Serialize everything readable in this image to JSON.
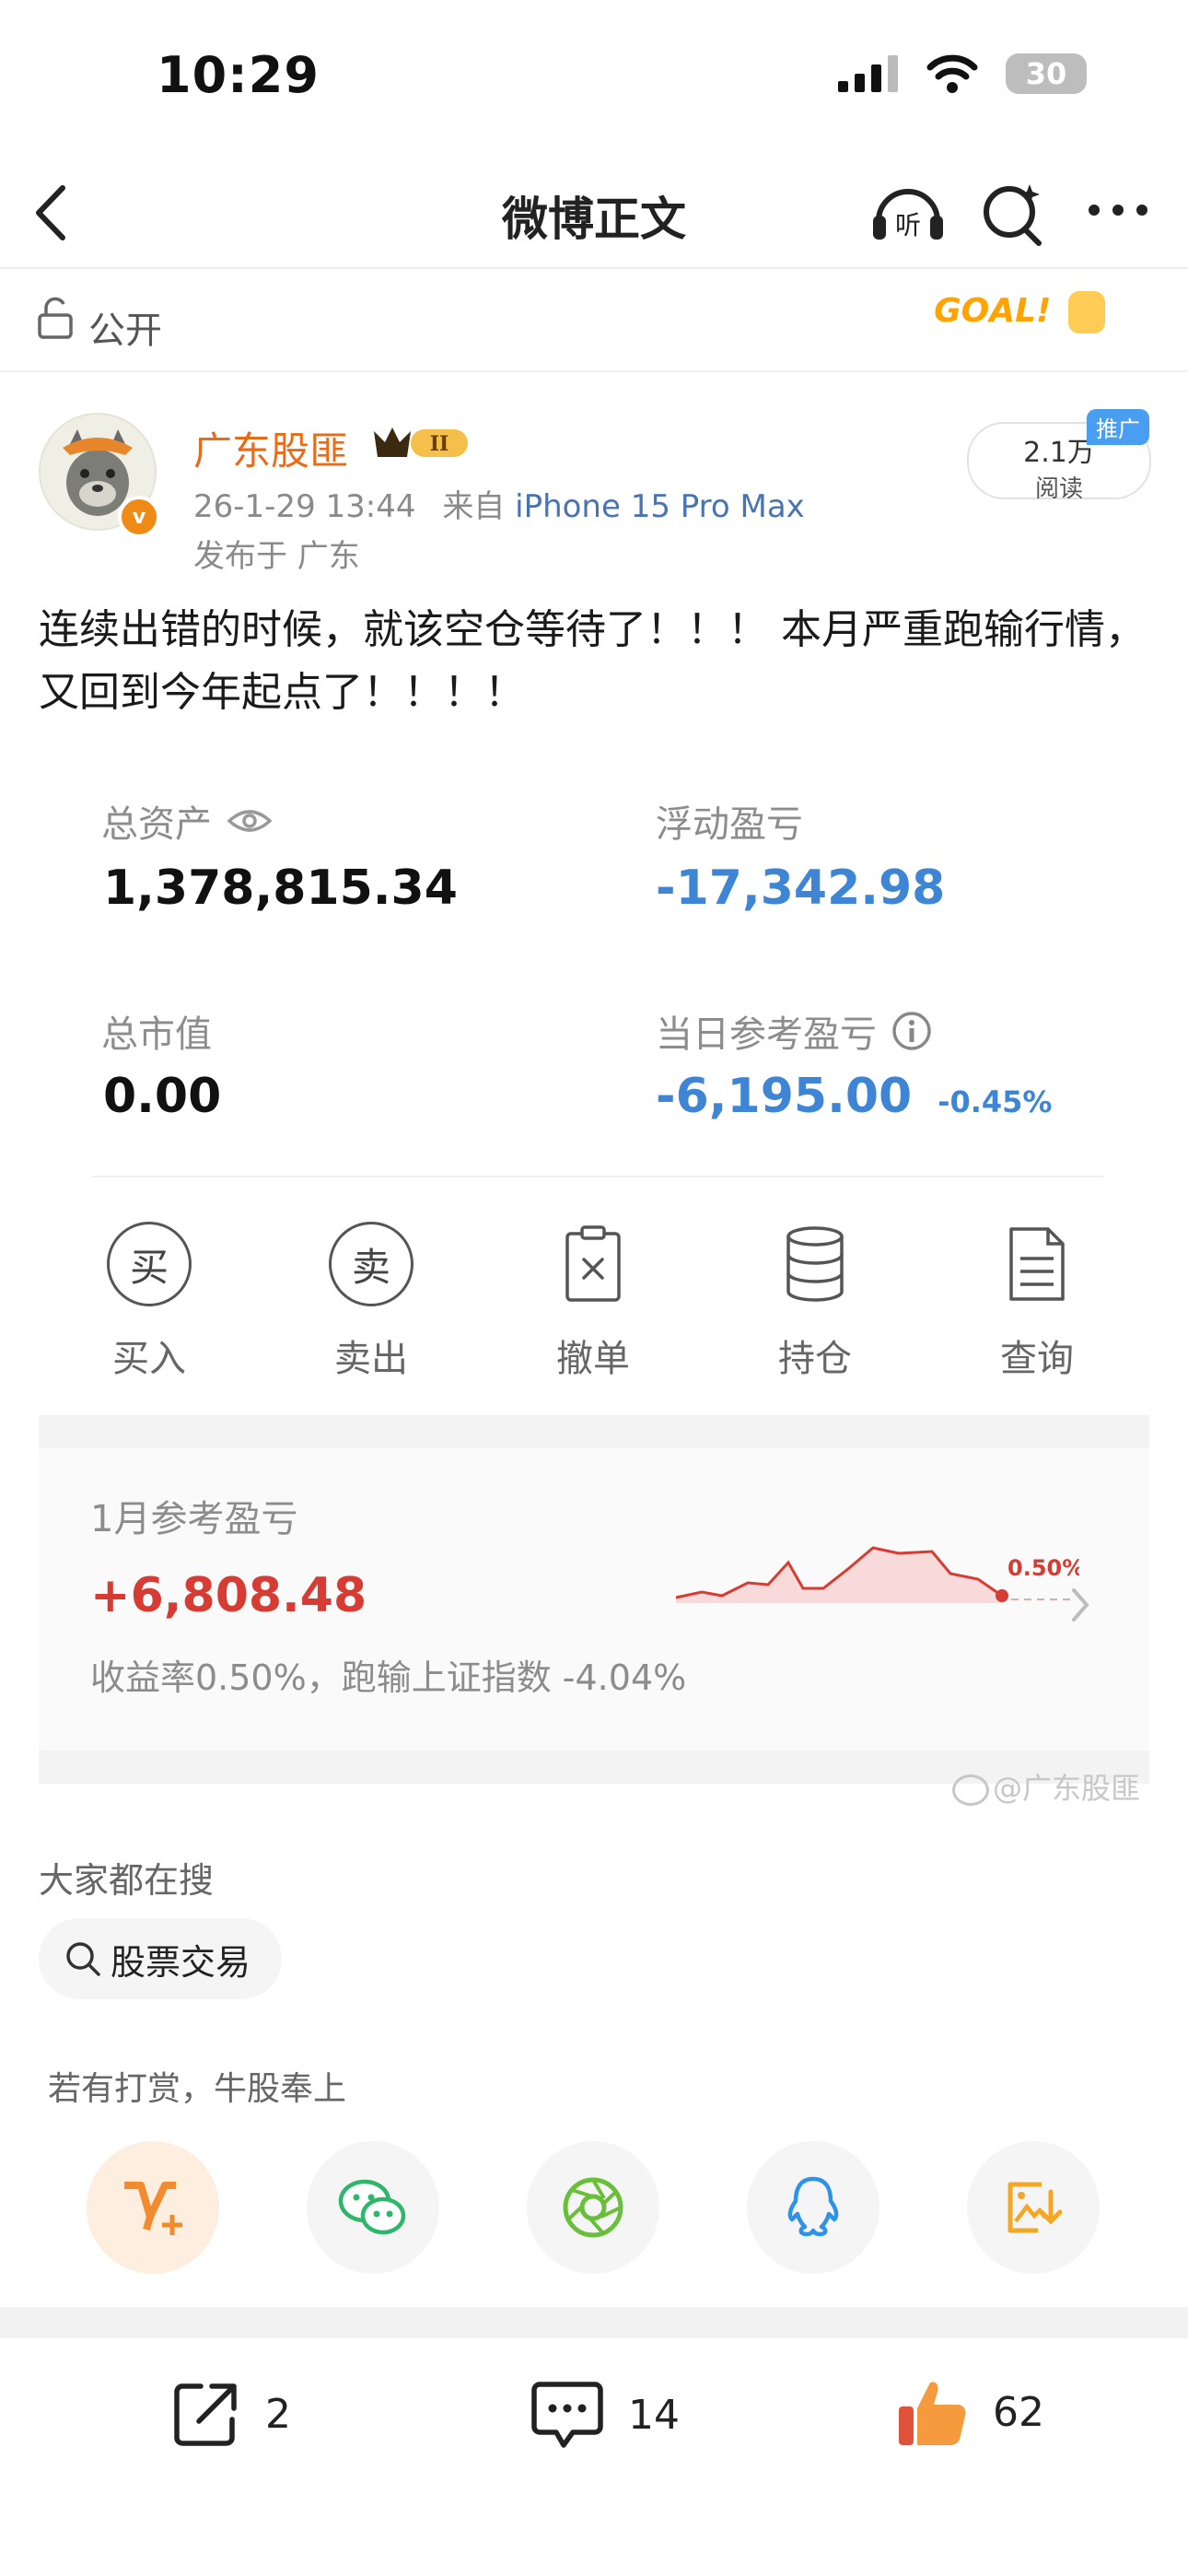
{
  "status": {
    "time": "10:29",
    "battery": "30"
  },
  "nav": {
    "title": "微博正文"
  },
  "visibility": {
    "label": "公开",
    "sticker": "GOAL!"
  },
  "post": {
    "author": "广东股匪",
    "vip_badge": "II",
    "time": "26-1-29 13:44",
    "via": "来自",
    "device": "iPhone 15 Pro Max",
    "location": "发布于 广东",
    "reads": "2.1万",
    "reads_label": "阅读",
    "ad_tag": "推广",
    "text": "连续出错的时候，就该空仓等待了！！！ 本月严重跑输行情，又回到今年起点了！！！！"
  },
  "account": {
    "total_assets_label": "总资产",
    "total_assets": "1,378,815.34",
    "floating_pl_label": "浮动盈亏",
    "floating_pl": "-17,342.98",
    "market_value_label": "总市值",
    "market_value": "0.00",
    "daily_pl_label": "当日参考盈亏",
    "daily_pl": "-6,195.00",
    "daily_pl_pct": "-0.45%"
  },
  "actions": [
    {
      "label": "买入",
      "glyph": "买"
    },
    {
      "label": "卖出",
      "glyph": "卖"
    },
    {
      "label": "撤单",
      "icon": "cancel-order-icon"
    },
    {
      "label": "持仓",
      "icon": "database-icon"
    },
    {
      "label": "查询",
      "icon": "document-icon"
    }
  ],
  "monthly": {
    "title": "1月参考盈亏",
    "value": "+6,808.48",
    "sub": "收益率0.50%，跑输上证指数 -4.04%",
    "chart_end_label": "0.50%"
  },
  "watermark": "@广东股匪",
  "search": {
    "header": "大家都在搜",
    "chip": "股票交易"
  },
  "reward": {
    "label": "若有打赏，牛股奉上"
  },
  "share_icons": [
    "vplus-icon",
    "wechat-icon",
    "moments-icon",
    "qq-icon",
    "save-image-icon"
  ],
  "bottom": {
    "reposts": "2",
    "comments": "14",
    "likes": "62"
  },
  "colors": {
    "author": "#ec6a16",
    "negative": "#3e85d6",
    "positive": "#d63c34",
    "vplus": "#f28a2e"
  }
}
